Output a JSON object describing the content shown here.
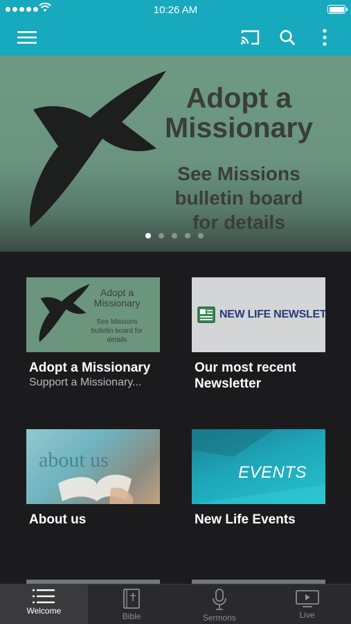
{
  "status_bar": {
    "time": "10:26 AM"
  },
  "nav": {
    "icons": [
      "menu-icon",
      "cast-icon",
      "search-icon",
      "more-vertical-icon"
    ]
  },
  "hero": {
    "title": "Adopt a Missionary",
    "subtitle": "See Missions bulletin board for details",
    "page_count": 5,
    "active_page": 1
  },
  "cards": [
    {
      "title": "Adopt a Missionary",
      "subtitle": "Support a Missionary...",
      "thumb_title": "Adopt a Missionary",
      "thumb_subtitle": "See Missions bulletin board for details"
    },
    {
      "title": "Our most recent Newsletter",
      "thumb_text": "NEW LIFE NEWSLETTER"
    },
    {
      "title": "About us",
      "thumb_text": "about us"
    },
    {
      "title": "New Life Events",
      "thumb_text": "EVENTS"
    }
  ],
  "tabs": [
    {
      "label": "Welcome",
      "icon": "list-icon",
      "active": true
    },
    {
      "label": "Bible",
      "icon": "bible-icon",
      "active": false
    },
    {
      "label": "Sermons",
      "icon": "microphone-icon",
      "active": false
    },
    {
      "label": "Live",
      "icon": "play-video-icon",
      "active": false
    }
  ],
  "colors": {
    "brand": "#17a9bd",
    "background": "#1b1b1d",
    "tab_bar": "#2a2a2c"
  }
}
